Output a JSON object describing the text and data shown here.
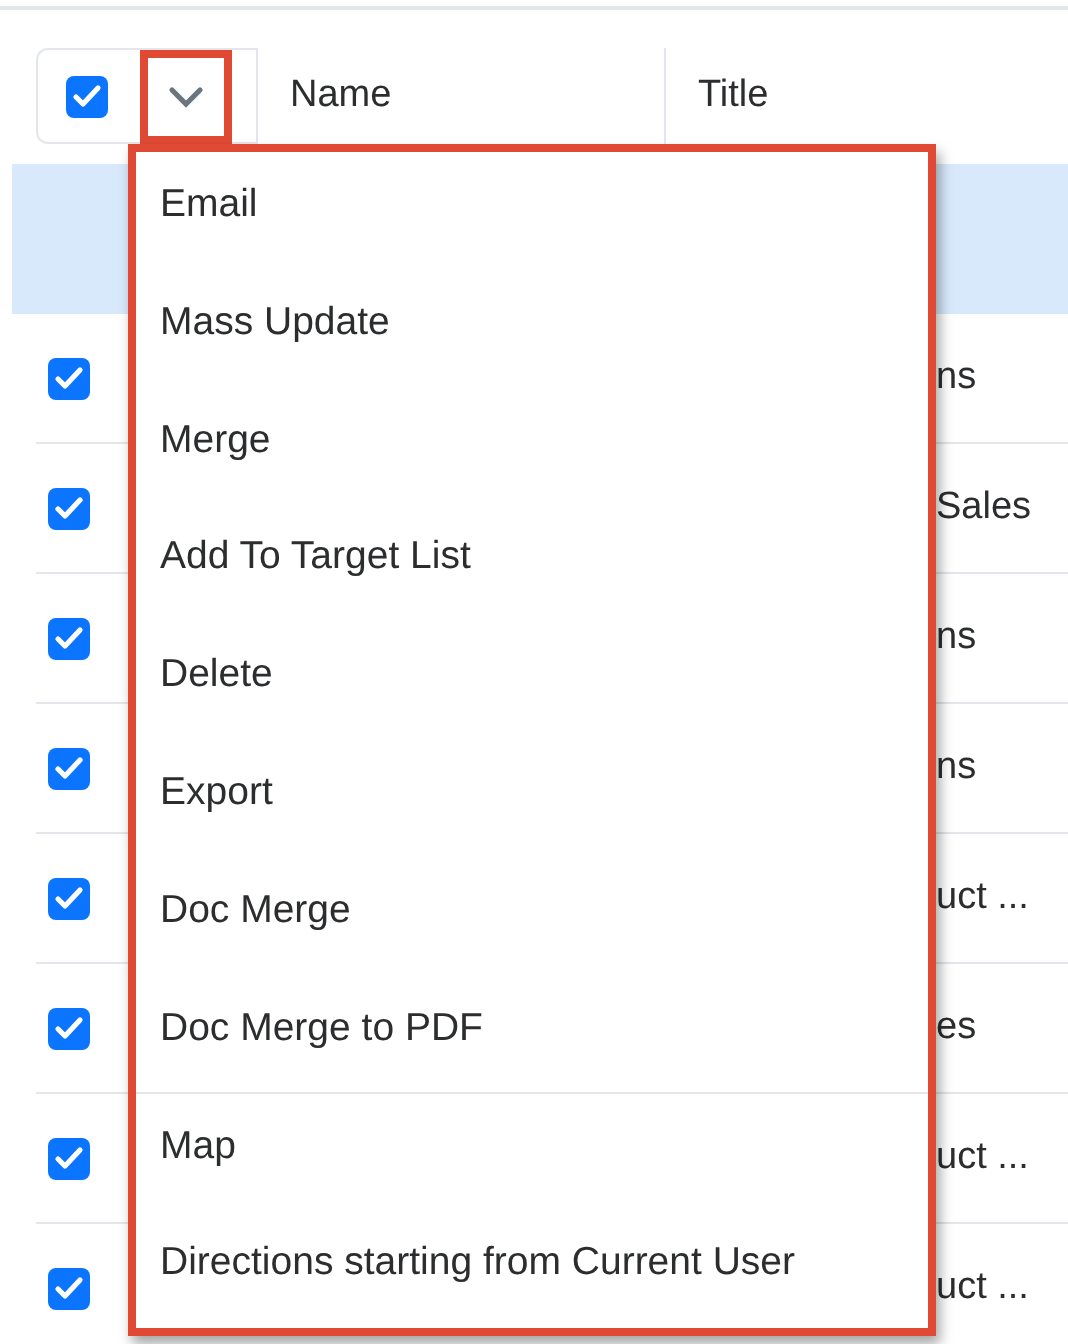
{
  "table": {
    "select_all": {
      "checked": true
    },
    "columns": [
      "Name",
      "Title"
    ],
    "rows": [
      {
        "checked": true,
        "title": "ns"
      },
      {
        "checked": true,
        "title": "Sales"
      },
      {
        "checked": true,
        "title": "ns"
      },
      {
        "checked": true,
        "title": "ns"
      },
      {
        "checked": true,
        "title": "uct ..."
      },
      {
        "checked": true,
        "title": "es"
      },
      {
        "checked": true,
        "title": "uct ..."
      },
      {
        "checked": true,
        "title": "uct ..."
      }
    ]
  },
  "actions_menu": {
    "expanded": true,
    "items": [
      {
        "label": "Email",
        "separated": false
      },
      {
        "label": "Mass Update",
        "separated": false
      },
      {
        "label": "Merge",
        "separated": false
      },
      {
        "label": "Add To Target List",
        "separated": false
      },
      {
        "label": "Delete",
        "separated": false
      },
      {
        "label": "Export",
        "separated": false
      },
      {
        "label": "Doc Merge",
        "separated": false
      },
      {
        "label": "Doc Merge to PDF",
        "separated": false
      },
      {
        "label": "Map",
        "separated": true
      },
      {
        "label": "Directions starting from Current User",
        "separated": false
      }
    ]
  }
}
